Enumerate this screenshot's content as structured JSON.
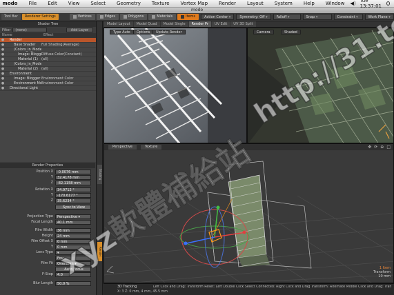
{
  "menubar": {
    "app": "modo",
    "items": [
      "File",
      "Edit",
      "View",
      "Select",
      "Geometry",
      "Texture",
      "Vertex Map",
      "Render",
      "Layout",
      "System",
      "Help",
      "Window"
    ],
    "clock": "Tue 13:37:01"
  },
  "window": {
    "title": "modo"
  },
  "toolbar": {
    "tabs": [
      {
        "label": "Tool Bar"
      },
      {
        "label": "Renderer Settings"
      }
    ],
    "selection_modes": [
      {
        "label": "Vertices"
      },
      {
        "label": "Edges"
      },
      {
        "label": "Polygons"
      },
      {
        "label": "Materials"
      },
      {
        "label": "Items"
      }
    ],
    "dropdowns": [
      {
        "label": "Action Center"
      },
      {
        "label": "Symmetry: Off"
      },
      {
        "label": "Falloff"
      },
      {
        "label": "Snap"
      },
      {
        "label": "Constraint"
      },
      {
        "label": "Work Plane"
      }
    ]
  },
  "shader_tree": {
    "title": "Shader Tree",
    "filter_label": "Filter",
    "filter_value": "(none)",
    "add_layer": "Add Layer",
    "columns": {
      "name": "Name",
      "effect": "Effect"
    },
    "rows": [
      {
        "name": "Render",
        "effect": ""
      },
      {
        "name": "Base Shader",
        "effect": "Full Shading(Average)"
      },
      {
        "name": "(Colors_in_Mode...",
        "effect": ""
      },
      {
        "name": "Image: Blogger...",
        "effect": "Diffuse Color(Constant)"
      },
      {
        "name": "Material (1)",
        "effect": "(all)"
      },
      {
        "name": "(Colors_in_Mode...",
        "effect": ""
      },
      {
        "name": "Material (2)",
        "effect": "(all)"
      },
      {
        "name": "Environment",
        "effect": ""
      },
      {
        "name": "Image: Blogger 8...",
        "effect": "Environment Color"
      },
      {
        "name": "Environment Mode...",
        "effect": "Environment Color"
      },
      {
        "name": "Directional Light",
        "effect": ""
      }
    ]
  },
  "render_properties": {
    "title": "Render Properties",
    "fields": [
      {
        "label": "Position X",
        "value": "-0.0076 mm"
      },
      {
        "label": "Y",
        "value": "32.4178 mm"
      },
      {
        "label": "Z",
        "value": "-82.1158 mm"
      },
      {
        "label": "Rotation X",
        "value": "34.9712 °"
      },
      {
        "label": "Y",
        "value": "-170.6177 °"
      },
      {
        "label": "Z",
        "value": "35.6234 °"
      },
      {
        "label": "",
        "value": "Sync to View"
      },
      {
        "label": "Projection Type",
        "value": "Perspective"
      },
      {
        "label": "Focal Length",
        "value": "40.1 mm"
      },
      {
        "label": "Film Width",
        "value": "36 mm"
      },
      {
        "label": "Height",
        "value": "24 mm"
      },
      {
        "label": "Film Offset X",
        "value": "0 mm"
      },
      {
        "label": "Y",
        "value": "0 mm"
      },
      {
        "label": "Lens Type",
        "value": ""
      },
      {
        "label": "",
        "value": "Fov"
      },
      {
        "label": "Film Fit",
        "value": "Overscan"
      },
      {
        "label": "",
        "value": "Auto Focus"
      },
      {
        "label": "F-Stop",
        "value": "4.0"
      },
      {
        "label": "Blur Length",
        "value": "50.0 %"
      }
    ]
  },
  "side_tabs": [
    "Shading",
    "Render"
  ],
  "viewport_tabs": [
    {
      "label": "Model Layout"
    },
    {
      "label": "Model Quad"
    },
    {
      "label": "Model Single"
    },
    {
      "label": "Render Pr"
    },
    {
      "label": "UV Edit"
    },
    {
      "label": "UV 3D Split"
    }
  ],
  "render_view": {
    "buttons": [
      "Type Auto",
      "Options",
      "Update Render"
    ]
  },
  "camera_view": {
    "header": "Camera",
    "mode": "Shaded"
  },
  "perspective_view": {
    "header": "Perspective",
    "mode": "Texture",
    "selected_count": "1 Item",
    "tool_label": "Transform",
    "scale_label": "10 mm"
  },
  "statusbar": {
    "tool": "3D Tracking",
    "hints": "Left Click and Drag: Transform  Reset: Left Double Click  Select Connected: Right Click and Drag  Transform: Alternate  Middle Click and Drag: Transform Clone",
    "coords": "X: 3  Z: 0 mm, 4 mm, 45.5 mm"
  },
  "watermark": {
    "text_cn": "xyz軟體補給站",
    "url": "http://31.to"
  },
  "colors": {
    "accent": "#e07a1c",
    "selection": "#b9552a"
  }
}
